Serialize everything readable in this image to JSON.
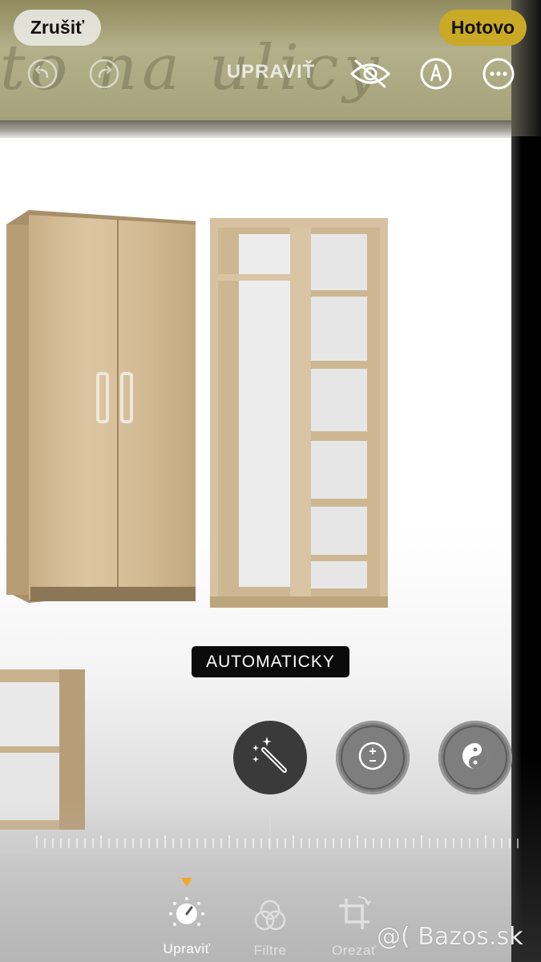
{
  "header": {
    "cancel_label": "Zrušiť",
    "done_label": "Hotovo",
    "title": "UPRAVIŤ",
    "icons": [
      "undo-icon",
      "redo-icon",
      "hide-eye-icon",
      "markup-pen-icon",
      "more-icon"
    ]
  },
  "photo": {
    "background_text": "to na ulicy"
  },
  "adjustment": {
    "current_label": "AUTOMATICKY",
    "tools": [
      {
        "name": "auto-enhance",
        "icon": "magic-wand-icon",
        "selected": true
      },
      {
        "name": "exposure",
        "icon": "exposure-icon",
        "selected": false
      },
      {
        "name": "brilliance",
        "icon": "brilliance-icon",
        "selected": false
      }
    ]
  },
  "tabs": [
    {
      "label": "Upraviť",
      "icon": "adjust-dial-icon",
      "active": true
    },
    {
      "label": "Filtre",
      "icon": "filters-icon",
      "active": false
    },
    {
      "label": "Orezať",
      "icon": "crop-rotate-icon",
      "active": false
    }
  ],
  "watermark": "@( Bazos.sk",
  "colors": {
    "accent": "#c9a926",
    "active_tab": "#ffffff",
    "inactive_tab": "#e0e0e0",
    "indicator": "#f5a623"
  }
}
